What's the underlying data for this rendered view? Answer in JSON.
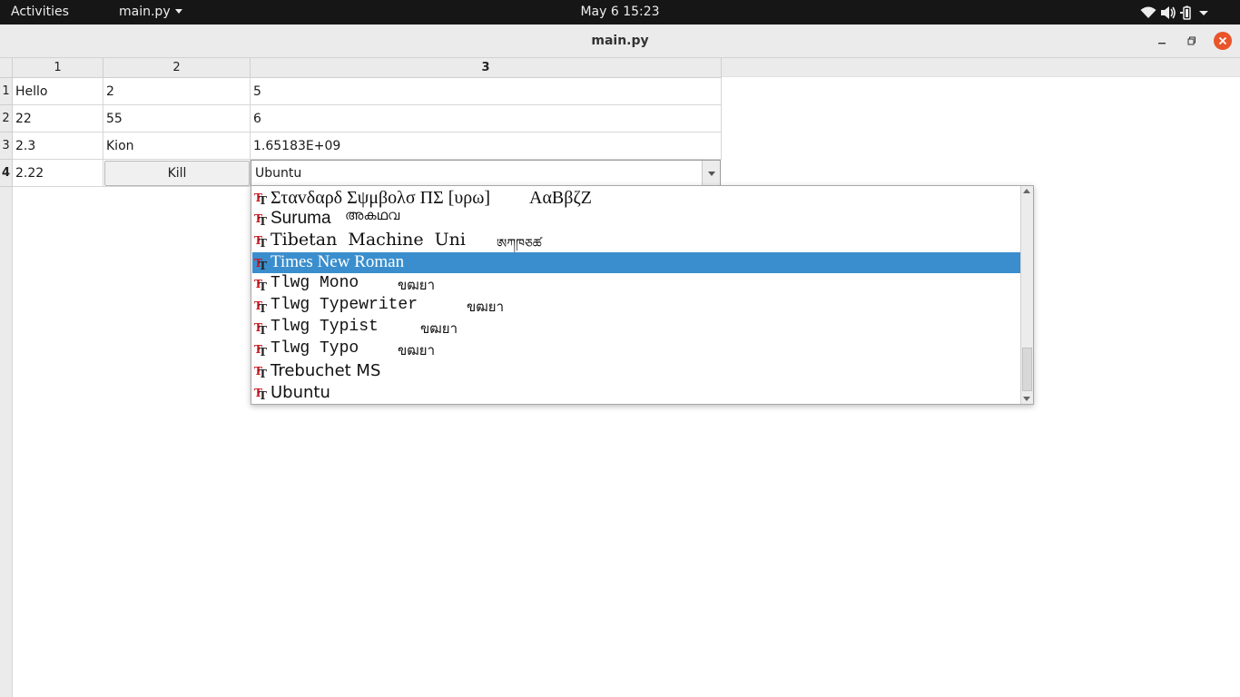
{
  "topbar": {
    "activities": "Activities",
    "app_menu": "main.py",
    "clock": "May 6  15:23",
    "tray_icons": [
      "wifi-icon",
      "volume-icon",
      "battery-icon",
      "chevron-down-icon"
    ]
  },
  "window": {
    "title": "main.py",
    "close_color": "#e9542b"
  },
  "table": {
    "columns": [
      "1",
      "2",
      "3"
    ],
    "rows": [
      "1",
      "2",
      "3",
      "4"
    ],
    "cells": [
      [
        "Hello",
        "2",
        "5"
      ],
      [
        "22",
        "55",
        "6"
      ],
      [
        "2.3",
        "Kion",
        "1.65183E+09"
      ],
      [
        "2.22",
        "Kill",
        "Ubuntu"
      ]
    ],
    "current_row": "4",
    "current_column": "3"
  },
  "font_combo": {
    "value": "Ubuntu",
    "items": [
      {
        "name": "Σταvδαρδ Σψμβολσ ΠΣ [υρω]",
        "sample": "ΑαΒβζΖ",
        "selected": false
      },
      {
        "name": "Suruma",
        "sample": "അകഥവ",
        "selected": false
      },
      {
        "name": "Tibetan Machine Uni",
        "sample": "ཨཀཁཅཚ",
        "selected": false
      },
      {
        "name": "Times New Roman",
        "sample": "",
        "selected": true
      },
      {
        "name": "Tlwg Mono",
        "sample": "ขฒยา",
        "selected": false
      },
      {
        "name": "Tlwg Typewriter",
        "sample": "ขฒยา",
        "selected": false
      },
      {
        "name": "Tlwg Typist",
        "sample": "ขฒยา",
        "selected": false
      },
      {
        "name": "Tlwg Typo",
        "sample": "ขฒยา",
        "selected": false
      },
      {
        "name": "Trebuchet MS",
        "sample": "",
        "selected": false
      },
      {
        "name": "Ubuntu",
        "sample": "",
        "selected": false
      }
    ],
    "selected_color": "#3a8ecd",
    "font_icon": "truetype-font-icon"
  }
}
